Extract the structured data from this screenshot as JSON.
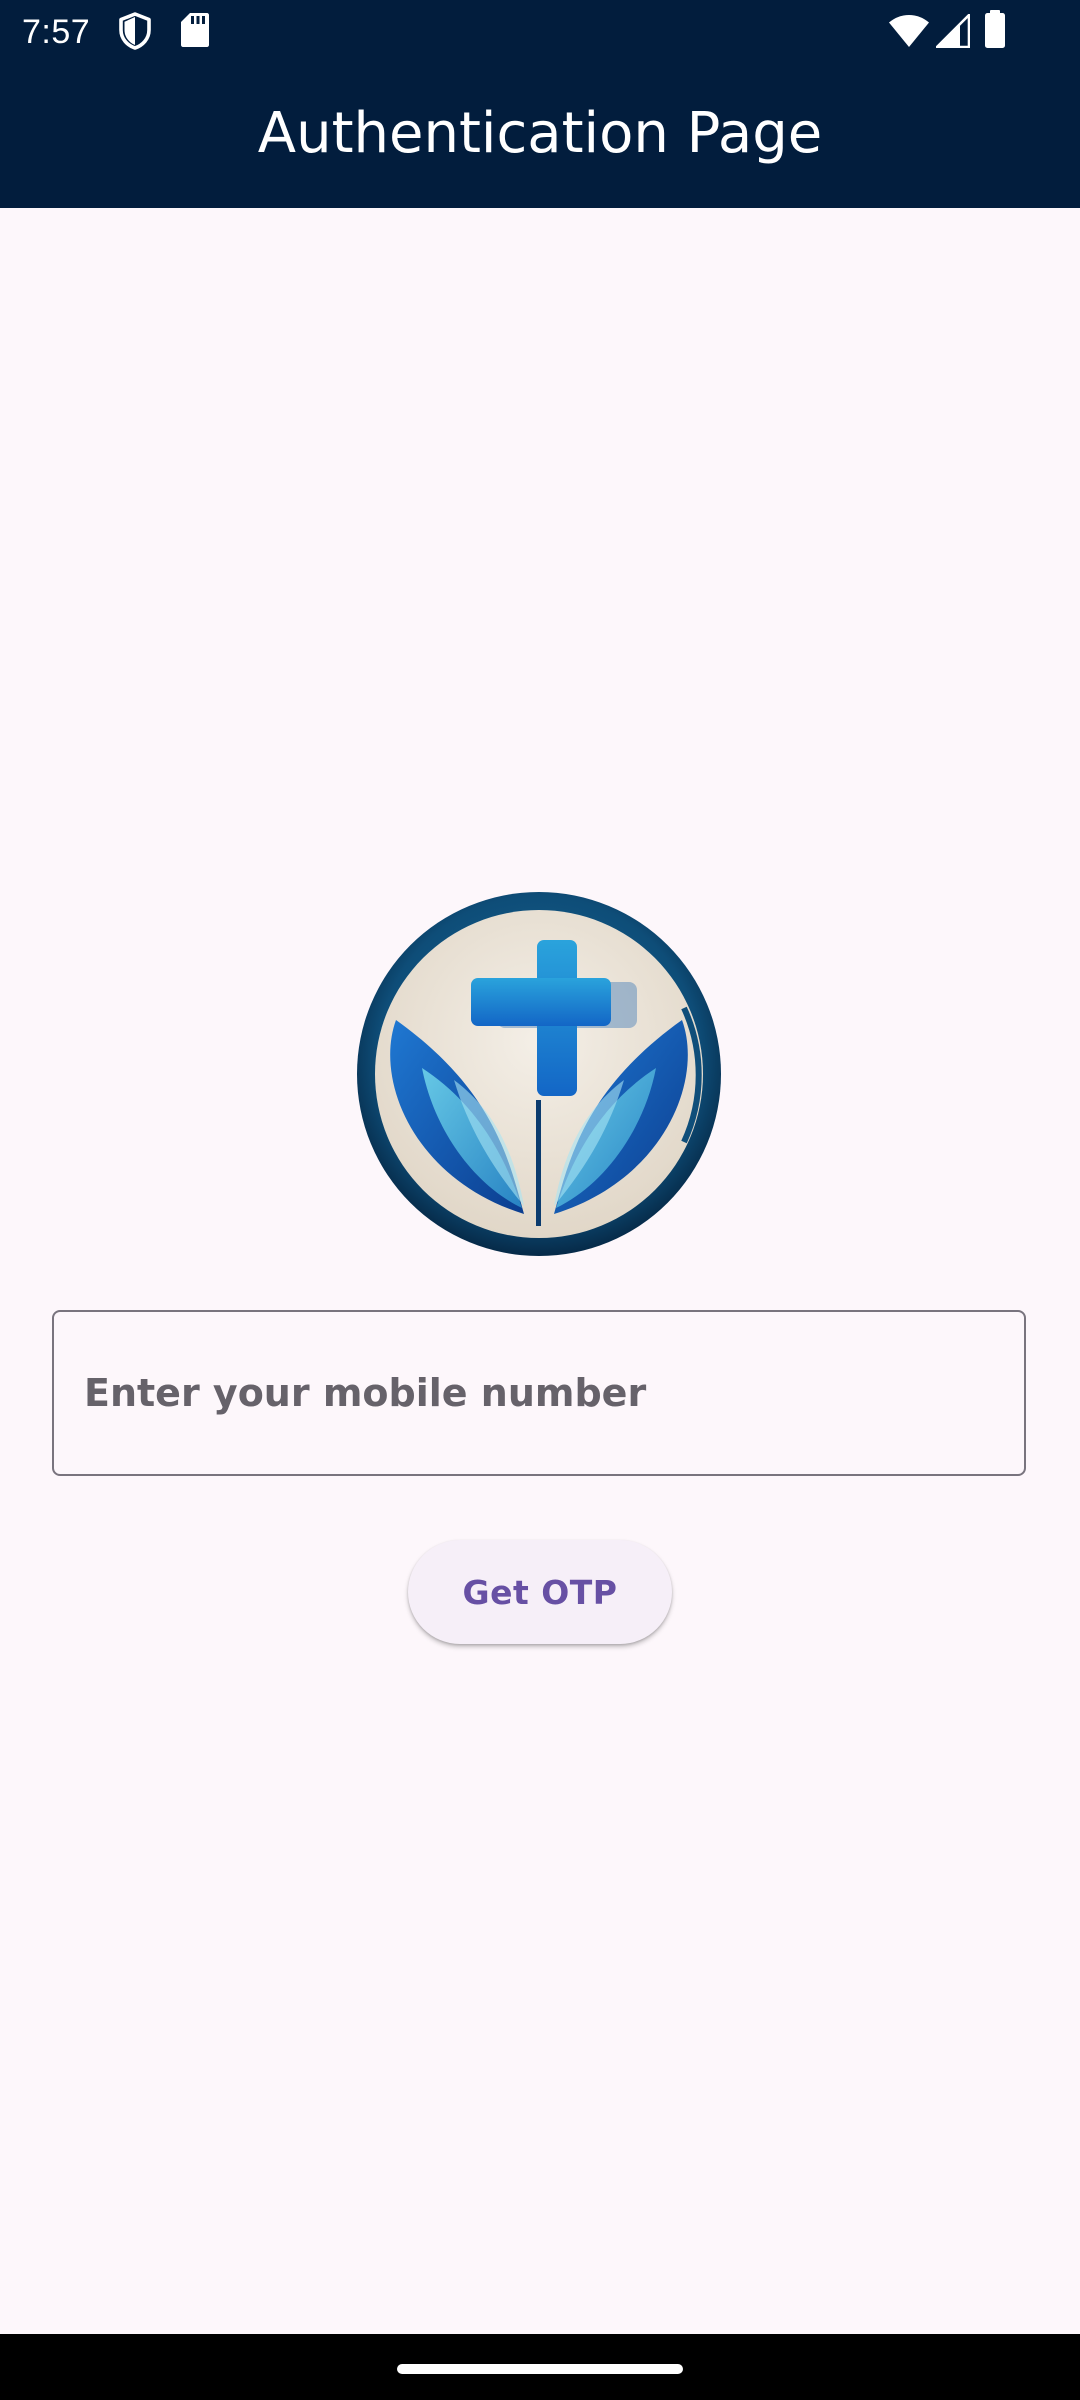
{
  "status_bar": {
    "time": "7:57",
    "icons": [
      "shield-icon",
      "sd-card-icon",
      "wifi-icon",
      "cellular-signal-icon",
      "battery-icon"
    ]
  },
  "app_bar": {
    "title": "Authentication Page",
    "background_color": "#021d3d"
  },
  "logo": {
    "icon": "medical-cross-leaves-logo"
  },
  "login_form": {
    "mobile_placeholder": "Enter your mobile number",
    "mobile_value": "",
    "submit_label": "Get OTP",
    "accent_color": "#6750a4"
  },
  "colors": {
    "page_background": "#fdf7fb",
    "field_border": "#79747e"
  }
}
